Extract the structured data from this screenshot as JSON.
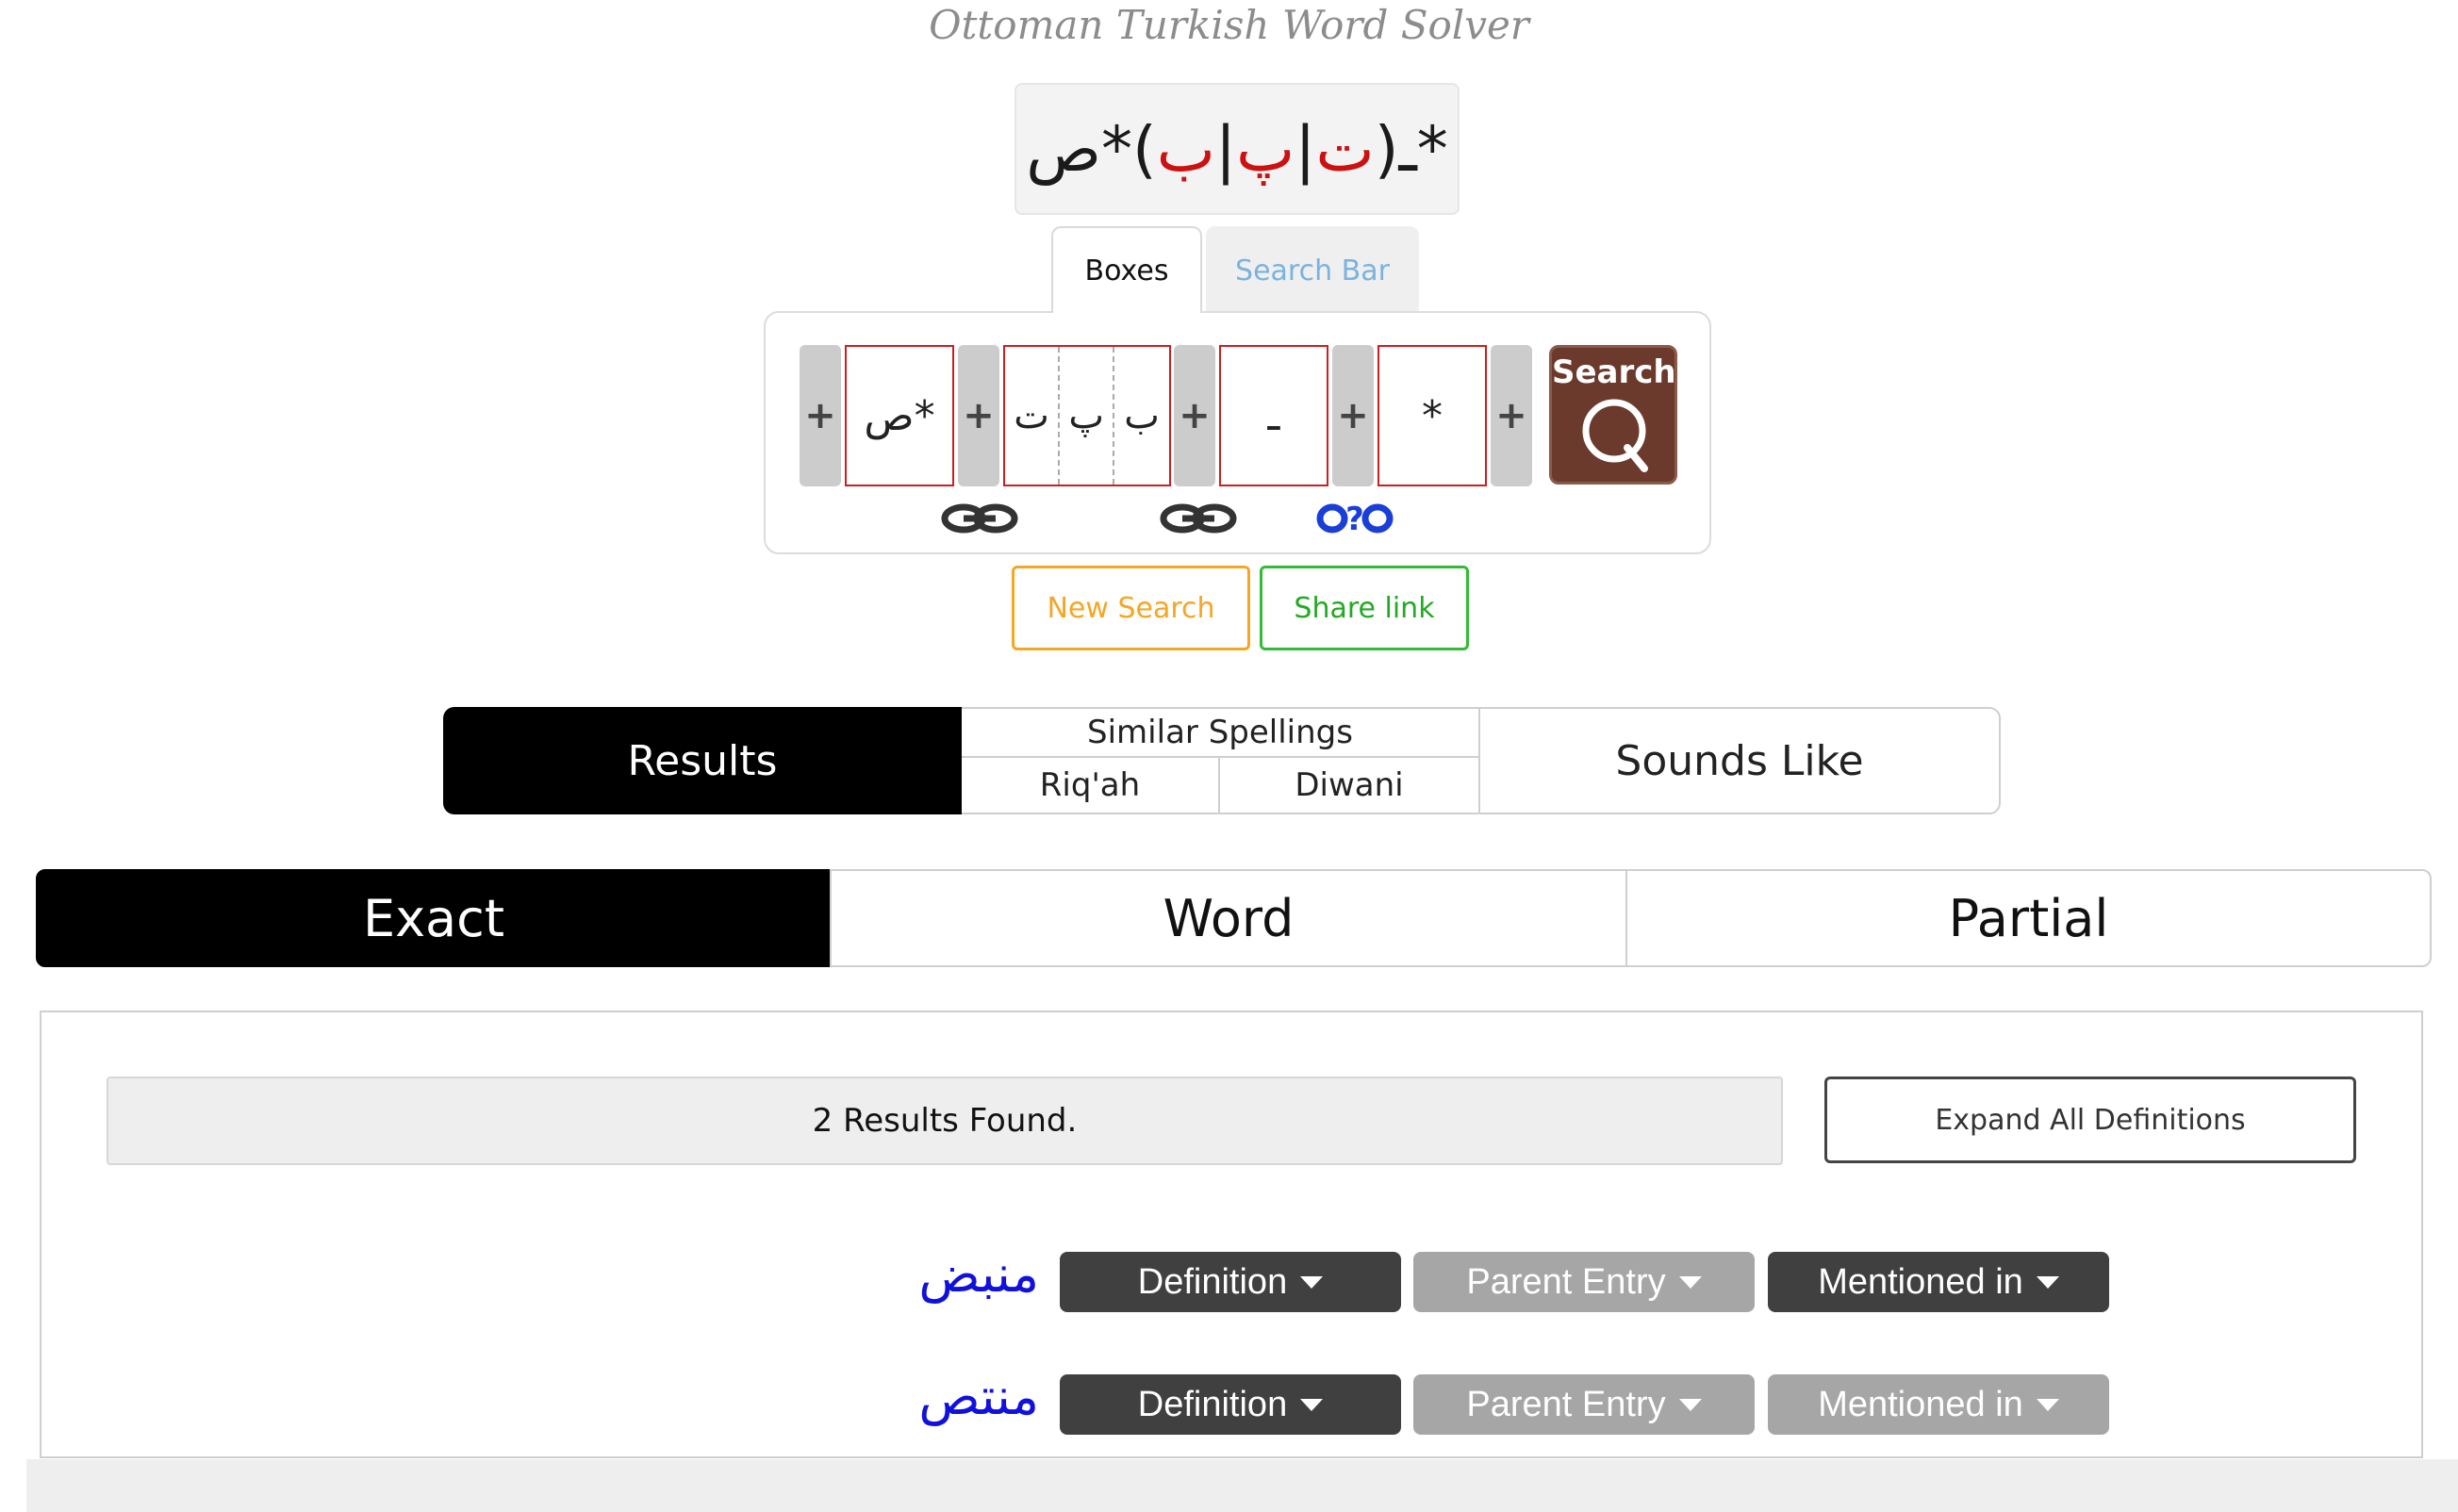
{
  "app": {
    "title": "Ottoman Turkish Word Solver"
  },
  "pattern": {
    "prefix": "ص*(",
    "alt1": "ب",
    "sep1": "|",
    "alt2": "پ",
    "sep2": "|",
    "alt3": "ت",
    "suffix": ")ـ*"
  },
  "input_tabs": {
    "boxes": "Boxes",
    "search_bar": "Search Bar"
  },
  "boxes": {
    "plus": "+",
    "box1": "ص*",
    "box2_chars": [
      "ت",
      "پ",
      "ب"
    ],
    "box3": "ـ",
    "box4": "*",
    "link_label_1": "⚭",
    "search_label": "Search"
  },
  "actions": {
    "new_search": "New Search",
    "share_link": "Share link"
  },
  "result_types": {
    "results": "Results",
    "similar_spellings": "Similar Spellings",
    "riqah": "Riq'ah",
    "diwani": "Diwani",
    "sounds_like": "Sounds Like"
  },
  "match_modes": {
    "exact": "Exact",
    "word": "Word",
    "partial": "Partial"
  },
  "results": {
    "count_text": "2 Results Found.",
    "expand_label": "Expand All Definitions",
    "rows": [
      {
        "word": "منبض",
        "definition": "Definition",
        "parent": "Parent Entry",
        "mentioned": "Mentioned in"
      },
      {
        "word": "منتص",
        "definition": "Definition",
        "parent": "Parent Entry",
        "mentioned": "Mentioned in"
      }
    ]
  },
  "colors": {
    "accent_red": "#cc1f1f",
    "search_brown": "#6b3a2c",
    "word_blue": "#1111dd",
    "orange": "#f5a623",
    "green": "#33bb33"
  }
}
